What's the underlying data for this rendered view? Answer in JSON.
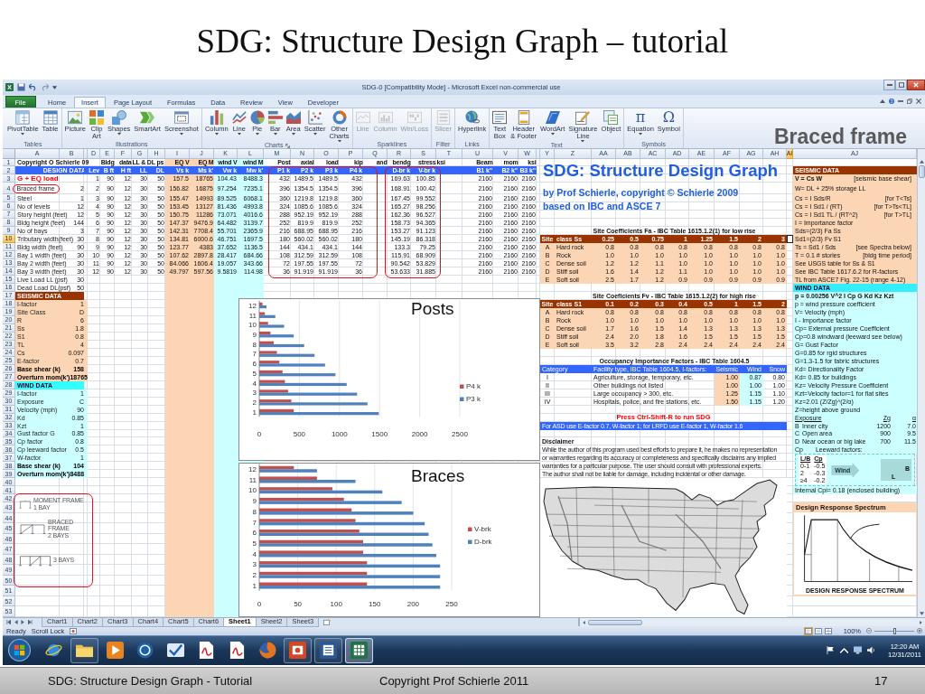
{
  "slide": {
    "title": "SDG: Structure Design Graph – tutorial"
  },
  "excel": {
    "title_bar": {
      "title": "SDG-0 [Compatibility Mode] - Microsoft Excel non-commercial use"
    },
    "ribbon": {
      "tabs": [
        {
          "label": "File",
          "kind": "backstage",
          "selected": false
        },
        {
          "label": "Home",
          "kind": "tab",
          "selected": false
        },
        {
          "label": "Insert",
          "kind": "tab",
          "selected": true
        },
        {
          "label": "Page Layout",
          "kind": "tab",
          "selected": false
        },
        {
          "label": "Formulas",
          "kind": "tab",
          "selected": false
        },
        {
          "label": "Data",
          "kind": "tab",
          "selected": false
        },
        {
          "label": "Review",
          "kind": "tab",
          "selected": false
        },
        {
          "label": "View",
          "kind": "tab",
          "selected": false
        },
        {
          "label": "Developer",
          "kind": "tab",
          "selected": false
        }
      ],
      "groups": [
        {
          "label": "Tables",
          "launcher": false,
          "buttons": [
            {
              "label": "PivotTable",
              "menu": true,
              "disabled": false
            },
            {
              "label": "Table",
              "menu": false,
              "disabled": false
            }
          ]
        },
        {
          "label": "Illustrations",
          "launcher": false,
          "buttons": [
            {
              "label": "Picture",
              "menu": false,
              "disabled": false
            },
            {
              "label": "Clip\nArt",
              "menu": false,
              "disabled": false
            },
            {
              "label": "Shapes",
              "menu": true,
              "disabled": false
            },
            {
              "label": "SmartArt",
              "menu": false,
              "disabled": false
            },
            {
              "label": "Screenshot",
              "menu": true,
              "disabled": false
            }
          ]
        },
        {
          "label": "Charts",
          "launcher": true,
          "buttons": [
            {
              "label": "Column",
              "menu": true,
              "disabled": false
            },
            {
              "label": "Line",
              "menu": true,
              "disabled": false
            },
            {
              "label": "Pie",
              "menu": true,
              "disabled": false
            },
            {
              "label": "Bar",
              "menu": true,
              "disabled": false
            },
            {
              "label": "Area",
              "menu": true,
              "disabled": false
            },
            {
              "label": "Scatter",
              "menu": true,
              "disabled": false
            },
            {
              "label": "Other\nCharts",
              "menu": true,
              "disabled": false
            }
          ]
        },
        {
          "label": "Sparklines",
          "launcher": false,
          "buttons": [
            {
              "label": "Line",
              "menu": false,
              "disabled": true
            },
            {
              "label": "Column",
              "menu": false,
              "disabled": true
            },
            {
              "label": "Win/Loss",
              "menu": false,
              "disabled": true
            }
          ]
        },
        {
          "label": "Filter",
          "launcher": false,
          "buttons": [
            {
              "label": "Slicer",
              "menu": false,
              "disabled": true
            }
          ]
        },
        {
          "label": "Links",
          "launcher": false,
          "buttons": [
            {
              "label": "Hyperlink",
              "menu": false,
              "disabled": false
            }
          ]
        },
        {
          "label": "Text",
          "launcher": false,
          "buttons": [
            {
              "label": "Text\nBox",
              "menu": false,
              "disabled": false
            },
            {
              "label": "Header\n& Footer",
              "menu": false,
              "disabled": false
            },
            {
              "label": "WordArt",
              "menu": true,
              "disabled": false
            },
            {
              "label": "Signature\nLine",
              "menu": true,
              "disabled": false
            },
            {
              "label": "Object",
              "menu": false,
              "disabled": false
            }
          ]
        },
        {
          "label": "Symbols",
          "launcher": false,
          "buttons": [
            {
              "label": "Equation",
              "menu": true,
              "disabled": false,
              "glyph": "π"
            },
            {
              "label": "Symbol",
              "menu": false,
              "disabled": false,
              "glyph": "Ω"
            }
          ]
        }
      ],
      "overlay_caption": "Braced frame"
    },
    "sheet": {
      "columns": [
        {
          "label": "A",
          "selected": false
        },
        {
          "label": "B",
          "selected": false
        },
        {
          "selected": false
        },
        {
          "label": "D",
          "selected": false
        },
        {
          "label": "E",
          "selected": false
        },
        {
          "label": "F",
          "selected": false
        },
        {
          "label": "G",
          "selected": false
        },
        {
          "label": "H",
          "selected": false
        },
        {
          "label": "I",
          "selected": false
        },
        {
          "label": "J",
          "selected": false
        },
        {
          "label": "K",
          "selected": false
        },
        {
          "label": "L",
          "selected": false
        },
        {
          "label": "M",
          "selected": false
        },
        {
          "label": "N",
          "selected": false
        },
        {
          "label": "O",
          "selected": false
        },
        {
          "label": "P",
          "selected": false
        },
        {
          "label": "Q",
          "selected": false
        },
        {
          "label": "R",
          "selected": false
        },
        {
          "label": "S",
          "selected": false
        },
        {
          "label": "T",
          "selected": false
        },
        {
          "label": "U",
          "selected": false
        },
        {
          "label": "V",
          "selected": false
        },
        {
          "label": "W",
          "selected": false
        },
        {
          "selected": false
        },
        {
          "label": "Y",
          "selected": false
        },
        {
          "label": "Z",
          "selected": false
        },
        {
          "label": "AA",
          "selected": false
        },
        {
          "label": "AB",
          "selected": false
        },
        {
          "label": "AC",
          "selected": false
        },
        {
          "label": "AD",
          "selected": false
        },
        {
          "label": "AE",
          "selected": false
        },
        {
          "label": "AF",
          "selected": false
        },
        {
          "label": "AG",
          "selected": false
        },
        {
          "label": "AH",
          "selected": false
        },
        {
          "label": "AI",
          "selected": true
        },
        {
          "label": "AJ",
          "selected": false
        }
      ],
      "rows": [
        {
          "label": "1",
          "selected": false
        },
        {
          "label": "2",
          "selected": false
        },
        {
          "label": "3",
          "selected": false
        },
        {
          "label": "4",
          "selected": false
        },
        {
          "label": "5",
          "selected": false
        },
        {
          "label": "6",
          "selected": false
        },
        {
          "label": "7",
          "selected": false
        },
        {
          "label": "8",
          "selected": false
        },
        {
          "label": "9",
          "selected": false
        },
        {
          "label": "10",
          "selected": true
        },
        {
          "label": "11",
          "selected": false
        },
        {
          "label": "12",
          "selected": false
        },
        {
          "label": "13",
          "selected": false
        },
        {
          "label": "14",
          "selected": false
        },
        {
          "label": "15",
          "selected": false
        },
        {
          "label": "16",
          "selected": false
        },
        {
          "label": "17",
          "selected": false
        },
        {
          "label": "18",
          "selected": false
        },
        {
          "label": "19",
          "selected": false
        },
        {
          "label": "20",
          "selected": false
        },
        {
          "label": "21",
          "selected": false
        },
        {
          "label": "22",
          "selected": false
        },
        {
          "label": "23",
          "selected": false
        },
        {
          "label": "24",
          "selected": false
        },
        {
          "label": "25",
          "selected": false
        },
        {
          "label": "26",
          "selected": false
        },
        {
          "label": "27",
          "selected": false
        },
        {
          "label": "28",
          "selected": false
        },
        {
          "label": "29",
          "selected": false
        },
        {
          "label": "30",
          "selected": false
        },
        {
          "label": "31",
          "selected": false
        },
        {
          "label": "32",
          "selected": false
        },
        {
          "label": "33",
          "selected": false
        },
        {
          "label": "34",
          "selected": false
        },
        {
          "label": "35",
          "selected": false
        },
        {
          "label": "36",
          "selected": false
        },
        {
          "label": "37",
          "selected": false
        },
        {
          "label": "38",
          "selected": false
        },
        {
          "label": "39",
          "selected": false
        },
        {
          "label": "40",
          "selected": false
        },
        {
          "label": "41",
          "selected": false
        },
        {
          "label": "42",
          "selected": false
        },
        {
          "label": "43",
          "selected": false
        },
        {
          "label": "44",
          "selected": false
        },
        {
          "label": "45",
          "selected": false
        },
        {
          "label": "46",
          "selected": false
        },
        {
          "label": "47",
          "selected": false
        },
        {
          "label": "48",
          "selected": false
        },
        {
          "label": "49",
          "selected": false
        },
        {
          "label": "50",
          "selected": false
        },
        {
          "label": "51",
          "selected": false
        },
        {
          "label": "52",
          "selected": false
        },
        {
          "label": "53",
          "selected": false
        }
      ],
      "left_panel": {
        "title": "Copyright O Schierle 09",
        "sections": [
          {
            "kind": "design",
            "heading": "DESIGN DATA",
            "rows": [
              {
                "kind": "load",
                "label": "G + EQ load"
              },
              {
                "kind": "field",
                "label": "Braced frame",
                "value": "2"
              },
              {
                "kind": "field",
                "label": "Steel",
                "value": "1"
              },
              {
                "kind": "field",
                "label": "No of levels",
                "value": "12"
              },
              {
                "kind": "field",
                "label": "Story height (feet)",
                "value": "12"
              },
              {
                "kind": "field",
                "label": "Bldg height (feet)",
                "value": "144"
              },
              {
                "kind": "field",
                "label": "No of bays",
                "value": "3"
              },
              {
                "kind": "field",
                "label": "Tributary width(feet)",
                "value": "30"
              },
              {
                "kind": "field",
                "label": "Bldg width (feet)",
                "value": "90"
              },
              {
                "kind": "field",
                "label": "Bay 1 width (feet)",
                "value": "30"
              },
              {
                "kind": "field",
                "label": "Bay 2 width (feet)",
                "value": "30"
              },
              {
                "kind": "field",
                "label": "Bay 3 width (feet)",
                "value": "30"
              },
              {
                "kind": "field",
                "label": "Live Load LL (psf)",
                "value": "30"
              },
              {
                "kind": "field",
                "label": "Dead Load DL(psf)",
                "value": "50"
              }
            ]
          },
          {
            "kind": "seismic",
            "heading": "SEISMIC DATA",
            "rows": [
              {
                "kind": "field",
                "label": "I-factor",
                "value": "1"
              },
              {
                "kind": "field",
                "label": "Site Class",
                "value": "D"
              },
              {
                "kind": "field",
                "label": "R",
                "value": "6"
              },
              {
                "kind": "field",
                "label": "Ss",
                "value": "1.8"
              },
              {
                "kind": "field",
                "label": "S1",
                "value": "0.8"
              },
              {
                "kind": "field",
                "label": "TL",
                "value": "4"
              },
              {
                "kind": "field",
                "label": "Cs",
                "value": "0.097"
              },
              {
                "kind": "field",
                "label": "E-factor",
                "value": "0.7"
              },
              {
                "kind": "total",
                "label": "Base shear (k)",
                "value": "158"
              },
              {
                "kind": "total",
                "label": "Overturn mom(k')",
                "value": "18765"
              }
            ]
          },
          {
            "kind": "wind",
            "heading": "WIND DATA",
            "rows": [
              {
                "kind": "field",
                "label": "I-factor",
                "value": "1"
              },
              {
                "kind": "field",
                "label": "Exposure",
                "value": "C"
              },
              {
                "kind": "field",
                "label": "Velocity (mph)",
                "value": "90"
              },
              {
                "kind": "field",
                "label": "Kd",
                "value": "0.85"
              },
              {
                "kind": "field",
                "label": "Kzt",
                "value": "1"
              },
              {
                "kind": "field",
                "label": "Gust factor G",
                "value": "0.85"
              },
              {
                "kind": "field",
                "label": "Cp factor",
                "value": "0.8"
              },
              {
                "kind": "field",
                "label": "Cp leeward factor",
                "value": "0.5"
              },
              {
                "kind": "field",
                "label": "W-factor",
                "value": "1"
              },
              {
                "kind": "total",
                "label": "Base shear (k)",
                "value": "104"
              },
              {
                "kind": "total",
                "label": "Overturn mom(k')",
                "value": "8488"
              }
            ]
          }
        ]
      },
      "frame_sketches": [
        {
          "kind": "portal",
          "title": "MOMENT FRAME",
          "note": "1 BAY"
        },
        {
          "kind": "twobay",
          "title": "BRACED FRAME",
          "note": "2 BAYS"
        },
        {
          "kind": "threebay",
          "note": "3 BAYS"
        }
      ],
      "design_table": {
        "columns": [
          {
            "header": "Lev"
          },
          {
            "group": "Bldg",
            "header": "B ft"
          },
          {
            "group": "data",
            "header": "H ft"
          },
          {
            "group": "LL & DL ps",
            "header": "LL"
          },
          {
            "header": "DL"
          },
          {
            "group": "EQ V",
            "header": "Vs k"
          },
          {
            "group": "EQ M",
            "header": "Ms k'"
          },
          {
            "group": "wind V",
            "header": "Vw k"
          },
          {
            "group": "wind M",
            "header": "Mw k'"
          },
          {
            "group": "Post",
            "header": "P1 k"
          },
          {
            "group": "axial",
            "header": "P2 k"
          },
          {
            "group": "load",
            "header": "P3 k"
          },
          {
            "group": "kip",
            "header": "P4 k"
          },
          {
            "group": "and"
          },
          {
            "group": "bendg",
            "header": "D-br k"
          },
          {
            "group": "stress",
            "header": "V-br k"
          },
          {
            "group": "ksi"
          },
          {
            "group": "Beam",
            "header": "B1 k\""
          },
          {
            "group": "mom",
            "header": "B2 k\""
          },
          {
            "group": "ksi",
            "header": "B3 k\""
          }
        ],
        "rows": [
          [
            "1",
            "90",
            "12",
            "30",
            "50",
            "157.5",
            "18765",
            "104.43",
            "8488.3",
            "432",
            "1489.5",
            "1489.5",
            "432",
            "",
            "169.63",
            "100.85",
            "",
            "2160",
            "2160",
            "2160"
          ],
          [
            "2",
            "90",
            "12",
            "30",
            "50",
            "156.82",
            "16875",
            "97.254",
            "7235.1",
            "396",
            "1354.5",
            "1354.5",
            "396",
            "",
            "168.91",
            "100.42",
            "",
            "2160",
            "2160",
            "2160"
          ],
          [
            "3",
            "90",
            "12",
            "30",
            "50",
            "155.47",
            "14993",
            "89.525",
            "6068.1",
            "360",
            "1219.8",
            "1219.8",
            "360",
            "",
            "167.45",
            "99.552",
            "",
            "2160",
            "2160",
            "2160"
          ],
          [
            "4",
            "90",
            "12",
            "30",
            "50",
            "153.45",
            "13127",
            "81.436",
            "4993.8",
            "324",
            "1085.6",
            "1085.6",
            "324",
            "",
            "165.27",
            "98.256",
            "",
            "2160",
            "2160",
            "2160"
          ],
          [
            "5",
            "90",
            "12",
            "30",
            "50",
            "150.75",
            "11286",
            "73.071",
            "4016.6",
            "288",
            "952.19",
            "952.19",
            "288",
            "",
            "162.36",
            "96.527",
            "",
            "2160",
            "2160",
            "2160"
          ],
          [
            "6",
            "90",
            "12",
            "30",
            "50",
            "147.37",
            "9476.9",
            "64.482",
            "3139.7",
            "252",
            "819.9",
            "819.9",
            "252",
            "",
            "158.73",
            "94.365",
            "",
            "2160",
            "2160",
            "2160"
          ],
          [
            "7",
            "90",
            "12",
            "30",
            "50",
            "142.31",
            "7708.4",
            "55.701",
            "2365.9",
            "216",
            "688.95",
            "688.95",
            "216",
            "",
            "153.27",
            "91.123",
            "",
            "2160",
            "2160",
            "2160"
          ],
          [
            "8",
            "90",
            "12",
            "30",
            "50",
            "134.81",
            "6000.6",
            "46.751",
            "1697.5",
            "180",
            "560.02",
            "560.02",
            "180",
            "",
            "145.19",
            "86.318",
            "",
            "2160",
            "2160",
            "2160"
          ],
          [
            "9",
            "90",
            "12",
            "30",
            "50",
            "123.77",
            "4383",
            "37.652",
            "1136.5",
            "144",
            "434.1",
            "434.1",
            "144",
            "",
            "133.3",
            "79.25",
            "",
            "2160",
            "2160",
            "2160"
          ],
          [
            "10",
            "90",
            "12",
            "30",
            "50",
            "107.62",
            "2897.8",
            "28.417",
            "684.66",
            "108",
            "312.59",
            "312.59",
            "108",
            "",
            "115.91",
            "68.909",
            "",
            "2160",
            "2160",
            "2160"
          ],
          [
            "11",
            "90",
            "12",
            "30",
            "50",
            "84.066",
            "1606.4",
            "19.057",
            "343.66",
            "72",
            "197.55",
            "197.55",
            "72",
            "",
            "90.542",
            "53.829",
            "",
            "2160",
            "2160",
            "2160"
          ],
          [
            "12",
            "90",
            "12",
            "30",
            "50",
            "49.797",
            "597.56",
            "9.5819",
            "114.98",
            "36",
            "91.919",
            "91.919",
            "36",
            "",
            "53.633",
            "31.885",
            "",
            "2160",
            "2160",
            "2160"
          ]
        ]
      },
      "charts": [
        {
          "callout": "Posts",
          "chart_data": {
            "type": "bar",
            "orientation": "horizontal",
            "categories": [
              "12",
              "11",
              "10",
              "9",
              "8",
              "7",
              "6",
              "5",
              "4",
              "3",
              "2",
              "1"
            ],
            "series": [
              {
                "name": "P4 k",
                "color": "#c0504d",
                "values": [
                  40,
                  70,
                  110,
                  140,
                  180,
                  220,
                  250,
                  290,
                  320,
                  360,
                  400,
                  430
                ]
              },
              {
                "name": "P3 k",
                "color": "#4f81bd",
                "values": [
                  90,
                  200,
                  310,
                  430,
                  560,
                  690,
                  820,
                  950,
                  1090,
                  1220,
                  1350,
                  1490
                ]
              }
            ],
            "xlim": [
              0,
              2500
            ],
            "xticks": [
              0,
              500,
              1000,
              1500,
              2000,
              2500
            ],
            "grid": true,
            "legend": "right"
          }
        },
        {
          "callout": "Braces",
          "chart_data": {
            "type": "bar",
            "orientation": "horizontal",
            "categories": [
              "12",
              "11",
              "10",
              "9",
              "8",
              "7",
              "6",
              "5",
              "4",
              "3",
              "2",
              "1"
            ],
            "series": [
              {
                "name": "V-brk",
                "color": "#c0504d",
                "values": [
                  45,
                  75,
                  95,
                  110,
                  120,
                  125,
                  130,
                  135,
                  135,
                  140,
                  140,
                  140
                ]
              },
              {
                "name": "D-brk",
                "color": "#4f81bd",
                "values": [
                  75,
                  125,
                  160,
                  185,
                  200,
                  215,
                  220,
                  225,
                  230,
                  235,
                  235,
                  235
                ]
              }
            ],
            "xlim": [
              0,
              250
            ],
            "xticks": [
              0,
              50,
              100,
              150,
              200,
              250
            ],
            "grid": true,
            "legend": "right"
          }
        }
      ],
      "sdg_panel": {
        "title": "SDG: Structure Design Graph",
        "byline": "by Prof Schierle, copyright © Schierle 2009",
        "basis": "based on IBC and ASCE 7",
        "coefficient_tables": [
          {
            "caption": "Site Coefficients Fa - IBC Table 1615.1.2(1) for low rise",
            "columns": [
              "Site",
              "class Ss",
              "0.25",
              "0.5",
              "0.75",
              "1",
              "1.25",
              "1.5",
              "2",
              "3"
            ],
            "rows": [
              [
                "A",
                "Hard rock",
                "0.8",
                "0.8",
                "0.8",
                "0.8",
                "0.8",
                "0.8",
                "0.8",
                "0.8"
              ],
              [
                "B",
                "Rock",
                "1.0",
                "1.0",
                "1.0",
                "1.0",
                "1.0",
                "1.0",
                "1.0",
                "1.0"
              ],
              [
                "C",
                "Dense soil",
                "1.2",
                "1.2",
                "1.1",
                "1.0",
                "1.0",
                "1.0",
                "1.0",
                "1.0"
              ],
              [
                "D",
                "Stiff soil",
                "1.6",
                "1.4",
                "1.2",
                "1.1",
                "1.0",
                "1.0",
                "1.0",
                "1.0"
              ],
              [
                "E",
                "Soft soil",
                "2.5",
                "1.7",
                "1.2",
                "0.9",
                "0.9",
                "0.9",
                "0.9",
                "0.9"
              ]
            ]
          },
          {
            "caption": "Site Coeficients Fv - IBC Table 1615.1.2(2) for high rise",
            "columns": [
              "Site",
              "class S1",
              "0.1",
              "0.2",
              "0.3",
              "0.4",
              "0.5",
              "1",
              "1.5",
              "2"
            ],
            "rows": [
              [
                "A",
                "Hard rock",
                "0.8",
                "0.8",
                "0.8",
                "0.8",
                "0.8",
                "0.8",
                "0.8",
                "0.8"
              ],
              [
                "B",
                "Rock",
                "1.0",
                "1.0",
                "1.0",
                "1.0",
                "1.0",
                "1.0",
                "1.0",
                "1.0"
              ],
              [
                "C",
                "Dense soil",
                "1.7",
                "1.6",
                "1.5",
                "1.4",
                "1.3",
                "1.3",
                "1.3",
                "1.3"
              ],
              [
                "D",
                "Stiff soil",
                "2.4",
                "2.0",
                "1.8",
                "1.6",
                "1.5",
                "1.5",
                "1.5",
                "1.5"
              ],
              [
                "E",
                "Soft soil",
                "3.5",
                "3.2",
                "2.8",
                "2.4",
                "2.4",
                "2.4",
                "2.4",
                "2.4"
              ]
            ]
          }
        ],
        "importance_table": {
          "caption": "Occupancy Importance Factors - IBC Table 1604.5",
          "columns": [
            "Category",
            "Facility type, IBC Table 1604.5, I-factors:",
            "Seismic",
            "Wind",
            "Snow"
          ],
          "rows": [
            [
              "I",
              "Agriculture, storage, temporary, etc.",
              "1.00",
              "0.87",
              "0.80"
            ],
            [
              "II",
              "Other buildings not listed",
              "1.00",
              "1.00",
              "1.00"
            ],
            [
              "III",
              "Large occupancy > 300, etc.",
              "1.25",
              "1.15",
              "1.10"
            ],
            [
              "IV",
              "Hospitals, police, and fire stations, etc.",
              "1.50",
              "1.15",
              "1.20"
            ]
          ]
        },
        "run_hint": "Press Ctrl-Shift-R to run SDG",
        "factor_note": "For ASD use E-factor 0.7, W-factor 1; for LRFD use E-factor 1, W-factor 1.6",
        "disclaimer": {
          "heading": "Disclaimer",
          "lines": [
            "While the author of this program used best efforts to prepare it, he makes no representation",
            "or warranties regarding its accuracy or completeness and specifically disclaims any implied",
            "warranties for a particular purpose.  The user should consult with professional experts.",
            "The author shall not be liable for damage, including incidental or other damage."
          ]
        }
      },
      "notes_panel": {
        "sections": [
          {
            "kind": "seismic",
            "heading": "SEISMIC DATA",
            "lines": [
              {
                "kind": "lead",
                "text": "V = Cs W",
                "note": "[seismic base shear]"
              },
              {
                "kind": "line",
                "text": "W= DL + 25% storage LL"
              },
              {
                "kind": "line",
                "text": "Cs = I Sds/R",
                "note": "[for T<Ts]"
              },
              {
                "kind": "line",
                "text": "Cs = I Sd1 / (RT)",
                "note": "[for T>Ts<TL]"
              },
              {
                "kind": "line",
                "text": "Cs = I Sd1 TL / (RT^2)",
                "note": "[for T>TL]"
              },
              {
                "kind": "line",
                "text": "I = Importance factor"
              },
              {
                "kind": "line",
                "text": "Sds=(2/3) Fa Ss"
              },
              {
                "kind": "line",
                "text": "Sd1=(2/3) Fv S1"
              },
              {
                "kind": "line",
                "text": "Ts = Sd1 / Sds",
                "note": "[see Spectra below]"
              },
              {
                "kind": "line",
                "text": "T = 0.1 # stories",
                "note": "[bldg time period]"
              },
              {
                "kind": "line",
                "text": "See USGS table for Ss & S1"
              },
              {
                "kind": "line",
                "text": "See IBC Table 1617.6.2 for R-factors"
              },
              {
                "kind": "line",
                "text": "TL from ASCE7 Fig. 22-15 (range 4-12)"
              }
            ]
          },
          {
            "kind": "wind",
            "heading": "WIND DATA",
            "lines": [
              {
                "kind": "lead",
                "text": "p = 0.00256 V^2 I Cp G Kd Kz Kzt"
              },
              {
                "kind": "line",
                "text": "p = wind pressure coefficient"
              },
              {
                "kind": "line",
                "text": "V= Velocity (mph)"
              },
              {
                "kind": "line",
                "text": "I - Importance factor"
              },
              {
                "kind": "line",
                "text": "Cp= External pressure Coefficient"
              },
              {
                "kind": "line",
                "text": "Cp=0.8 windward (leeward see below)"
              },
              {
                "kind": "line",
                "text": "G= Gust Factor"
              },
              {
                "kind": "line",
                "text": "G=0.85 for rgid structures"
              },
              {
                "kind": "line",
                "text": "G=1.3-1.5 for fabric structures"
              },
              {
                "kind": "line",
                "text": "Kd= Directionality Factor"
              },
              {
                "kind": "line",
                "text": "Kd= 0.85 for buildings"
              },
              {
                "kind": "line",
                "text": "Kz= Velocity Pressure Coefficient"
              },
              {
                "kind": "line",
                "text": "Kzt=Velocity factor=1 for flat sites"
              },
              {
                "kind": "line",
                "text": "Kz=2.01 (Z/Zg)^(2/α)"
              },
              {
                "kind": "line",
                "text": "Z=height above ground"
              }
            ]
          }
        ],
        "exposure": {
          "columns": [
            "Exposure",
            "",
            "Zg",
            "α"
          ],
          "rows": [
            [
              "B",
              "Inner city",
              "1200",
              "7.0"
            ],
            [
              "C",
              "Open area",
              "900",
              "9.5"
            ],
            [
              "D",
              "Near ocean or big lake",
              "700",
              "11.5"
            ]
          ]
        },
        "leeward": {
          "label": "Cp",
          "caption": "Leeward factors:",
          "columns": [
            "L/B",
            "Cp"
          ],
          "rows": [
            [
              "0-1",
              "-0.5"
            ],
            [
              "2",
              "-0.3"
            ],
            [
              "≥4",
              "-0.2"
            ]
          ],
          "wind_label": "Wind",
          "side_labels": [
            "B",
            "L"
          ]
        },
        "internal_note": "Internal Cpi= 0.18 (enclosed building)",
        "spectrum": {
          "heading": "Design Response Spectrum",
          "caption": "DESIGN RESPONSE SPECTRUM"
        }
      }
    },
    "sheet_tabs": [
      {
        "label": "Chart1",
        "selected": false
      },
      {
        "label": "Chart2",
        "selected": false
      },
      {
        "label": "Chart3",
        "selected": false
      },
      {
        "label": "Chart4",
        "selected": false
      },
      {
        "label": "Chart5",
        "selected": false
      },
      {
        "label": "Chart6",
        "selected": false
      },
      {
        "label": "Sheet1",
        "selected": true
      },
      {
        "label": "Sheet2",
        "selected": false
      },
      {
        "label": "Sheet3",
        "selected": false
      }
    ],
    "status_bar": {
      "mode": "Ready",
      "scroll_lock": "Scroll Lock",
      "zoom": {
        "label": "100%",
        "level": 0.5
      }
    }
  },
  "taskbar": {
    "apps": [
      {
        "running": false,
        "selected": false
      },
      {
        "running": true,
        "selected": false
      },
      {
        "running": false,
        "selected": false
      },
      {
        "running": false,
        "selected": false
      },
      {
        "running": false,
        "selected": false
      },
      {
        "running": false,
        "selected": false
      },
      {
        "running": false,
        "selected": false
      },
      {
        "running": false,
        "selected": false
      },
      {
        "running": true,
        "selected": false
      },
      {
        "running": true,
        "selected": false
      },
      {
        "running": true,
        "selected": true
      }
    ],
    "clock": {
      "time": "12:20 AM",
      "date": "12/31/2011"
    }
  },
  "footer": {
    "left": "SDG: Structure Design Graph - Tutorial",
    "center": "Copyright Prof Schierle 2011",
    "page": "17"
  }
}
